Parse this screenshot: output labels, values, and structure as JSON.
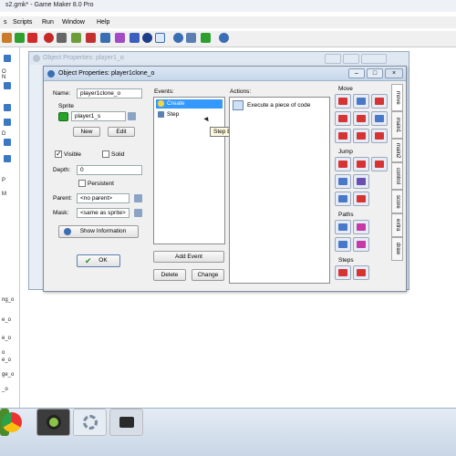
{
  "app": {
    "title": "s2.gmk* - Game Maker 8.0 Pro"
  },
  "menu": {
    "items": [
      "s",
      "Scripts",
      "Run",
      "Window",
      "Help"
    ]
  },
  "left_tree": {
    "items": [
      "O",
      "N",
      "D",
      "P",
      "M",
      "ng_o",
      "e_o",
      "e_o",
      "o",
      "e_o",
      "ge_o",
      "_o"
    ]
  },
  "bg_window": {
    "title": "Object Properties: player1_o"
  },
  "dialog": {
    "title": "Object Properties: player1clone_o",
    "name_label": "Name:",
    "name_value": "player1clone_o",
    "sprite_label": "Sprite",
    "sprite_value": "player1_s",
    "new_label": "New",
    "edit_label": "Edit",
    "visible_label": "Visible",
    "solid_label": "Solid",
    "depth_label": "Depth:",
    "depth_value": "0",
    "persistent_label": "Persistent",
    "parent_label": "Parent:",
    "parent_value": "<no parent>",
    "mask_label": "Mask:",
    "mask_value": "<same as sprite>",
    "show_info_label": "Show Information",
    "ok_label": "OK",
    "events_label": "Events:",
    "events": [
      "Create",
      "Step"
    ],
    "tooltip": "Step Event",
    "add_event_label": "Add Event",
    "delete_label": "Delete",
    "change_label": "Change",
    "actions_label": "Actions:",
    "actions": [
      "Execute a piece of code"
    ],
    "groups": {
      "move": "Move",
      "jump": "Jump",
      "paths": "Paths",
      "steps": "Steps"
    },
    "tabs": [
      "move",
      "main1",
      "main2",
      "control",
      "score",
      "extra",
      "draw"
    ]
  },
  "colors": {
    "accent": "#3399ff",
    "selection": "#3399ff"
  }
}
